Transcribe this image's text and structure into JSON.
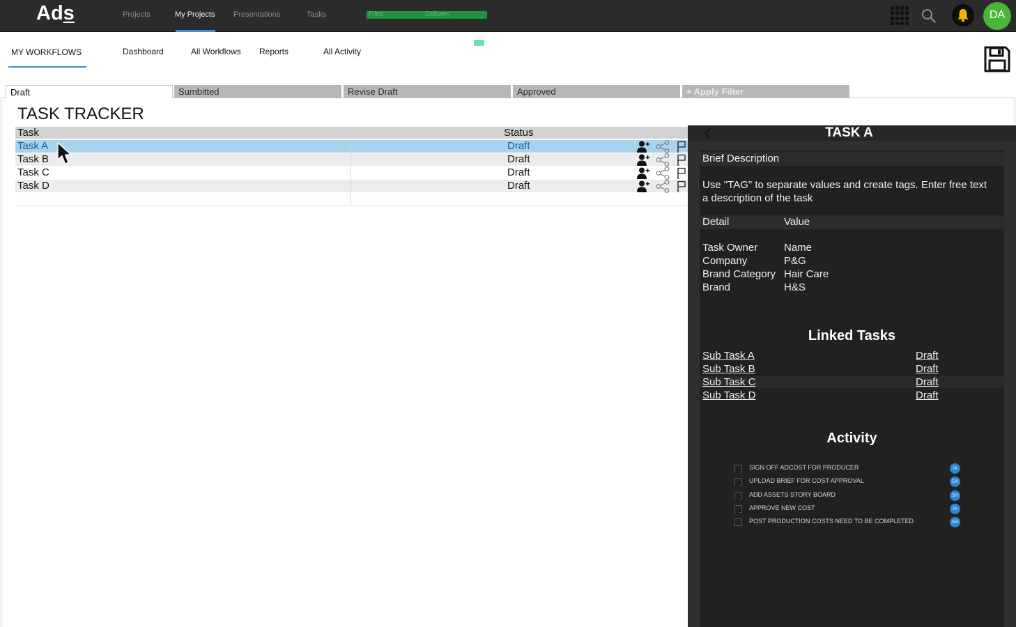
{
  "app": {
    "logo_prefix": "Ad",
    "logo_suffix": "s"
  },
  "topnav": {
    "items": [
      "Projects",
      "My Projects",
      "Presentations",
      "Tasks"
    ],
    "active": "My Projects",
    "pill_labels": [
      "Files",
      "Delivery"
    ],
    "avatar_initials": "DA"
  },
  "subnav": {
    "items": [
      "MY WORKFLOWS",
      "Dashboard",
      "All Workflows",
      "Reports",
      "All Activity"
    ],
    "active": "MY WORKFLOWS"
  },
  "tabs": {
    "items": [
      "Draft",
      "Sumbitted",
      "Revise Draft",
      "Approved"
    ],
    "active": "Draft",
    "filter_label": "+ Apply Filter"
  },
  "tracker": {
    "title": "TASK TRACKER",
    "columns": [
      "Task",
      "Status"
    ],
    "rows": [
      {
        "task": "Task A",
        "status": "Draft"
      },
      {
        "task": "Task B",
        "status": "Draft"
      },
      {
        "task": "Task C",
        "status": "Draft"
      },
      {
        "task": "Task D",
        "status": "Draft"
      }
    ],
    "selected_row": "Task A",
    "row_icons": [
      "add-user-icon",
      "share-icon",
      "flag-icon"
    ]
  },
  "panel": {
    "title": "TASK A",
    "brief_header": "Brief Description",
    "brief_text": "Use \"TAG\" to separate values and create tags. Enter free text a description of the task",
    "detail_header": "Detail",
    "value_header": "Value",
    "details": [
      {
        "label": "Task Owner",
        "value": "Name"
      },
      {
        "label": "Company",
        "value": "P&G"
      },
      {
        "label": "Brand Category",
        "value": "Hair Care"
      },
      {
        "label": "Brand",
        "value": "H&S"
      }
    ],
    "linked_title": "Linked Tasks",
    "linked": [
      {
        "name": "Sub Task A",
        "status": "Draft"
      },
      {
        "name": "Sub Task B",
        "status": "Draft"
      },
      {
        "name": "Sub Task C",
        "status": "Draft"
      },
      {
        "name": "Sub Task D",
        "status": "Draft"
      }
    ],
    "activity_title": "Activity",
    "activity": [
      {
        "label": "SIGN OFF ADCOST FOR PRODUCER",
        "initials": "IA",
        "checked": true
      },
      {
        "label": "UPLOAD BRIEF FOR COST APPROVAL",
        "initials": "DA",
        "checked": true
      },
      {
        "label": "ADD ASSETS STORY BOARD",
        "initials": "SH",
        "checked": true
      },
      {
        "label": "APPROVE NEW COST",
        "initials": "IA",
        "checked": true
      },
      {
        "label": "POST PRODUCTION COSTS NEED TO BE COMPLETED",
        "initials": "SH",
        "checked": false
      }
    ]
  },
  "colors": {
    "topbar": "#2b2b2b",
    "accent_blue": "#3a8fd8",
    "selection": "#a8d3ef",
    "avatar_green": "#4bb53a",
    "bell_yellow": "#f2b705",
    "pill_green": "#1f9140",
    "panel_dark": "#2f2f2f"
  }
}
